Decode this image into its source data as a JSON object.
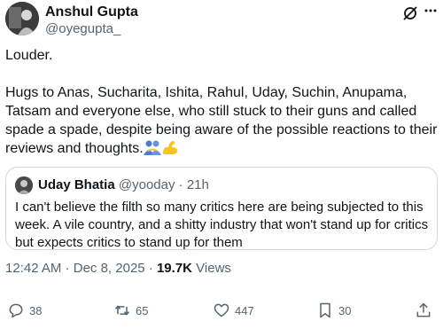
{
  "author": {
    "name": "Anshul Gupta",
    "handle": "@oyegupta_"
  },
  "tweet": {
    "paragraph1": "Louder.",
    "paragraph2": "Hugs to Anas, Sucharita, Ishita, Rahul, Uday, Suchin, Anupama, Tatsam and everyone else, who still stuck to their guns and called spade a spade, despite being aware of the possible reactions to their reviews and thoughts.",
    "emojis": [
      "people-hugging-emoji",
      "flexed-biceps-emoji"
    ]
  },
  "quote": {
    "name": "Uday Bhatia",
    "handle": "@yooday",
    "separator": "·",
    "time": "21h",
    "text": "I can't believe the filth so many critics here are being subjected to this week. A vile country, and a shitty industry that won't stand up for critics but expects critics to stand up for them"
  },
  "meta": {
    "time": "12:42 AM",
    "separator": "·",
    "date": "Dec 8, 2025",
    "views_count": "19.7K",
    "views_label": "Views"
  },
  "actions": {
    "replies": "38",
    "reposts": "65",
    "likes": "447",
    "bookmarks": "30"
  },
  "colors": {
    "text": "#0f1419",
    "secondary": "#536471",
    "border": "#cfd9de"
  }
}
